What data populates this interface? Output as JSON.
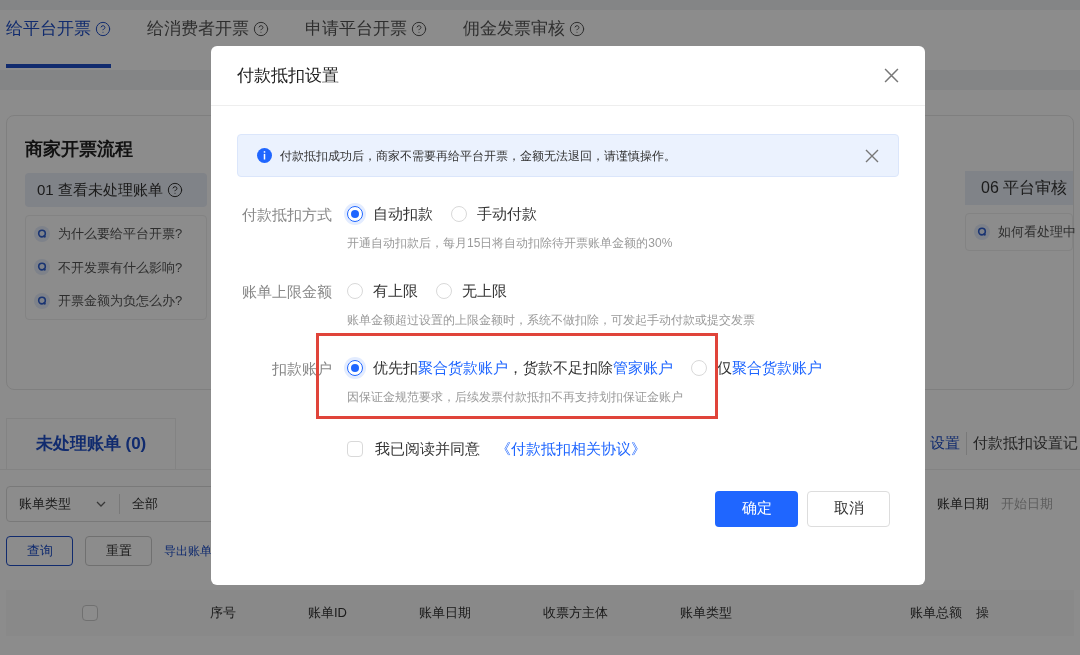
{
  "tabs": [
    {
      "label": "给平台开票",
      "selected": true
    },
    {
      "label": "给消费者开票",
      "selected": false
    },
    {
      "label": "申请平台开票",
      "selected": false
    },
    {
      "label": "佣金发票审核",
      "selected": false
    }
  ],
  "process": {
    "title": "商家开票流程",
    "steps": [
      {
        "label": "01 查看未处理账单",
        "help": true
      },
      {
        "label": "06 平台审核",
        "help": false
      }
    ],
    "questions_left": [
      "为什么要给平台开票?",
      "不开发票有什么影响?",
      "开票金额为负怎么办?"
    ],
    "questions_right": [
      "如何看处理中"
    ]
  },
  "bill_tabs": [
    {
      "label": "未处理账单 (0)",
      "selected": true
    }
  ],
  "right_links": [
    {
      "label": "设置",
      "kind": "link"
    },
    {
      "label": "付款抵扣设置记",
      "kind": "text"
    }
  ],
  "filters": {
    "type_label": "账单类型",
    "type_value": "全部",
    "date_label": "账单日期",
    "date_placeholder": "开始日期"
  },
  "actions": [
    {
      "label": "查询",
      "kind": "outline"
    },
    {
      "label": "重置",
      "kind": "default"
    },
    {
      "label": "导出账单",
      "kind": "link"
    }
  ],
  "table": {
    "select_all_checked": false,
    "columns": [
      "序号",
      "账单ID",
      "账单日期",
      "收票方主体",
      "账单类型",
      "账单总额",
      "操"
    ]
  },
  "dialog": {
    "title": "付款抵扣设置",
    "alert": "付款抵扣成功后，商家不需要再给平台开票，金额无法退回，请谨慎操作。",
    "fields": [
      {
        "label": "付款抵扣方式",
        "highlight": false,
        "hint": "开通自动扣款后，每月15日将自动扣除待开票账单金额的30%",
        "options": [
          {
            "selected": true,
            "segments": [
              {
                "text": "自动扣款",
                "link": false
              }
            ]
          },
          {
            "selected": false,
            "segments": [
              {
                "text": "手动付款",
                "link": false
              }
            ]
          }
        ]
      },
      {
        "label": "账单上限金额",
        "highlight": false,
        "hint": "账单金额超过设置的上限金额时，系统不做扣除，可发起手动付款或提交发票",
        "options": [
          {
            "selected": false,
            "segments": [
              {
                "text": "有上限",
                "link": false
              }
            ]
          },
          {
            "selected": false,
            "segments": [
              {
                "text": "无上限",
                "link": false
              }
            ]
          }
        ]
      },
      {
        "label": "扣款账户",
        "highlight": true,
        "hint": "因保证金规范要求，后续发票付款抵扣不再支持划扣保证金账户",
        "options": [
          {
            "selected": true,
            "segments": [
              {
                "text": "优先扣",
                "link": false
              },
              {
                "text": "聚合货款账户",
                "link": true
              },
              {
                "text": "，货款不足扣除",
                "link": false
              },
              {
                "text": "管家账户",
                "link": true
              }
            ]
          },
          {
            "selected": false,
            "segments": [
              {
                "text": "仅",
                "link": false
              },
              {
                "text": "聚合货款账户",
                "link": true
              }
            ]
          }
        ]
      }
    ],
    "agreement": {
      "text": "我已阅读并同意",
      "link": "《付款抵扣相关协议》",
      "checked": false
    },
    "buttons": [
      {
        "label": "确定",
        "kind": "primary"
      },
      {
        "label": "取消",
        "kind": "default"
      }
    ]
  }
}
